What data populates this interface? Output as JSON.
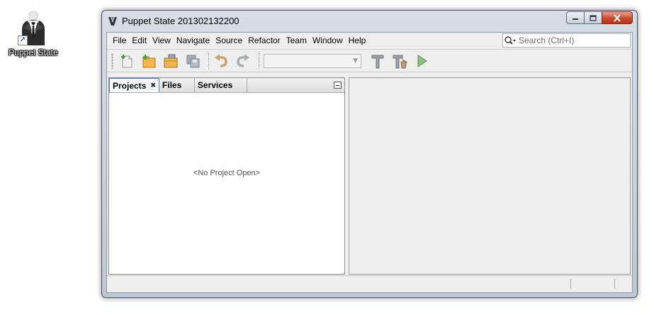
{
  "desktop": {
    "icon_label": "Puppet State",
    "icon_name": "tuxedo-icon"
  },
  "window": {
    "title": "Puppet State 201302132200",
    "controls": [
      "minimize-icon",
      "maximize-icon",
      "close-icon"
    ]
  },
  "menubar": {
    "items": [
      "File",
      "Edit",
      "View",
      "Navigate",
      "Source",
      "Refactor",
      "Team",
      "Window",
      "Help"
    ]
  },
  "search": {
    "placeholder": "Search (Ctrl+I)"
  },
  "toolbar": {
    "icons": [
      "new-file-icon",
      "new-project-icon",
      "open-project-icon",
      "save-all-icon",
      "undo-icon",
      "redo-icon",
      "build-icon",
      "clean-build-icon",
      "run-icon"
    ],
    "config_value": ""
  },
  "left_panel": {
    "tabs": [
      "Projects",
      "Files",
      "Services"
    ],
    "active_tab": "Projects",
    "empty_message": "<No Project Open>"
  },
  "colors": {
    "frame": "#bcc7d4",
    "close_button": "#c74a30",
    "client_bg": "#eeeeee"
  }
}
